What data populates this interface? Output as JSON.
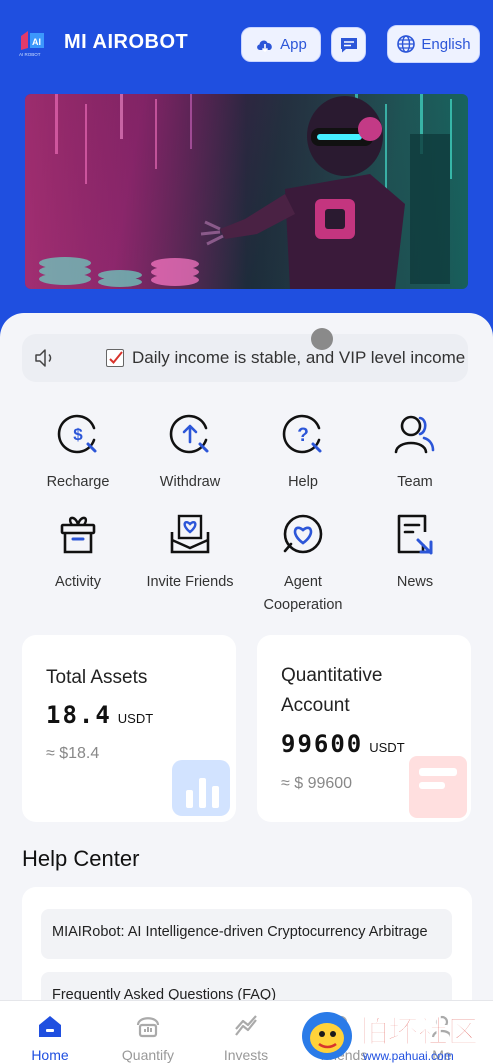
{
  "header": {
    "app_name": "MI AIROBOT",
    "logo_text": "AI ROBOT",
    "app_button": "App",
    "language_button": "English"
  },
  "notice": {
    "text": "Daily income is stable, and VIP level income"
  },
  "menu": [
    {
      "label": "Recharge",
      "icon": "recharge-icon"
    },
    {
      "label": "Withdraw",
      "icon": "withdraw-icon"
    },
    {
      "label": "Help",
      "icon": "help-icon"
    },
    {
      "label": "Team",
      "icon": "team-icon"
    },
    {
      "label": "Activity",
      "icon": "gift-icon"
    },
    {
      "label": "Invite Friends",
      "icon": "invite-icon"
    },
    {
      "label": "Agent Cooperation",
      "icon": "agent-icon"
    },
    {
      "label": "News",
      "icon": "news-icon"
    }
  ],
  "assets": {
    "total": {
      "title": "Total Assets",
      "value": "18.4",
      "unit": "USDT",
      "approx": "≈ $18.4"
    },
    "quant": {
      "title": "Quantitative Account",
      "value": "99600",
      "unit": "USDT",
      "approx": "≈ $ 99600"
    }
  },
  "help_center": {
    "title": "Help Center",
    "items": [
      "MIAIRobot: AI Intelligence-driven Cryptocurrency Arbitrage",
      "Frequently Asked Questions (FAQ)"
    ]
  },
  "tabs": [
    {
      "label": "Home",
      "active": true
    },
    {
      "label": "Quantify",
      "active": false
    },
    {
      "label": "Invests",
      "active": false
    },
    {
      "label": "Friends",
      "active": false
    },
    {
      "label": "Me",
      "active": false
    }
  ],
  "watermark": {
    "text": "怕坏社区",
    "url": "www.pahuai.com"
  },
  "colors": {
    "primary": "#1f4fe0",
    "accent_blue": "#2c56d8",
    "background": "#f4f5f9"
  }
}
